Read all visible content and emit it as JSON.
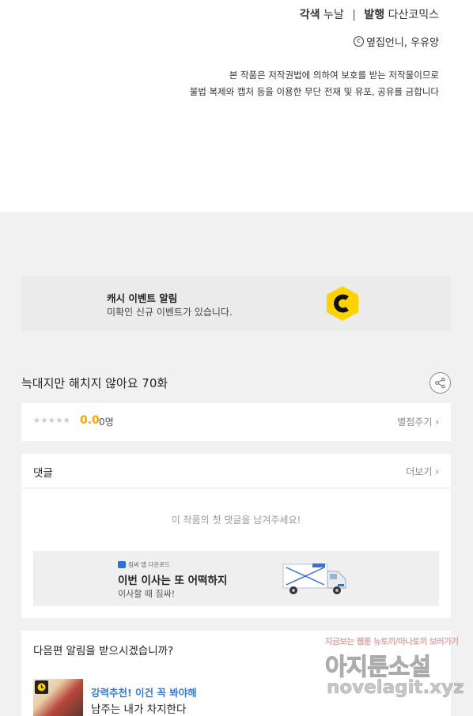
{
  "credits": {
    "color_role": "각색",
    "color_name": "누날",
    "publish_role": "발행",
    "publish_name": "다산코믹스",
    "separator": "|",
    "copyright_symbol": "c",
    "copyright_text": "옆집언니, 우유양"
  },
  "notice": {
    "line1": "본 작품은 저작권법에 의하여 보호를 받는 저작물이므로",
    "line2": "불법 복제와 캡처 등을 이용한 무단 전재 및 유포, 공유를 금합니다"
  },
  "event_banner": {
    "title": "캐시 이벤트 알림",
    "subtitle": "미확인 신규 이벤트가 있습니다.",
    "icon": "cash-c-icon",
    "icon_color": "#ffd200"
  },
  "episode": {
    "title": "늑대지만 해치지 않아요 70화",
    "share_icon": "share-icon"
  },
  "rating": {
    "stars": "★★★★★",
    "stars_value": 0,
    "score": "0.0",
    "count": "0명",
    "rate_button": "별점주기 ›",
    "score_color": "#f5a300"
  },
  "comments": {
    "title": "댓글",
    "more": "더보기 ›",
    "empty_message": "이 작품의 첫 댓글을 남겨주세요!"
  },
  "ad": {
    "tag": "짐싸 앱 다운로드",
    "title": "이번 이사는 또 어떡하지",
    "subtitle": "이사할 때 짐싸!",
    "image": "moving-truck"
  },
  "next": {
    "title": "다음편 알림을 받으시겠습니까?",
    "rec_tag": "강력추천! 이건 꼭 봐야해",
    "rec_title": "남주는 내가 차지한다",
    "rec_tag_color": "#3b7bd8"
  },
  "watermark": {
    "top": "지금보는 웹툰 뉴토끼/마나토끼 보러가기",
    "main": "아지툰소설",
    "url": "novelagit.xyz"
  }
}
